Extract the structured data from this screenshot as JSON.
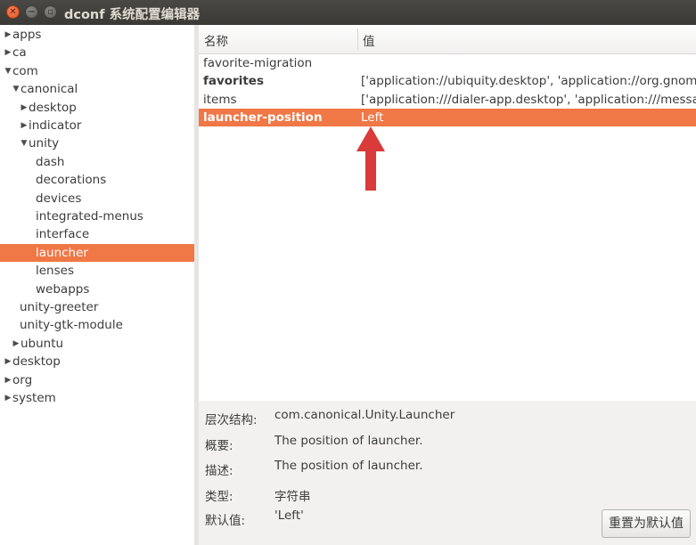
{
  "window": {
    "title": "dconf 系统配置编辑器"
  },
  "tree": [
    {
      "label": "apps",
      "depth": 0,
      "arrow": "right",
      "selected": false
    },
    {
      "label": "ca",
      "depth": 0,
      "arrow": "right",
      "selected": false
    },
    {
      "label": "com",
      "depth": 0,
      "arrow": "down",
      "selected": false
    },
    {
      "label": "canonical",
      "depth": 1,
      "arrow": "down",
      "selected": false
    },
    {
      "label": "desktop",
      "depth": 2,
      "arrow": "right",
      "selected": false
    },
    {
      "label": "indicator",
      "depth": 2,
      "arrow": "right",
      "selected": false
    },
    {
      "label": "unity",
      "depth": 2,
      "arrow": "down",
      "selected": false
    },
    {
      "label": "dash",
      "depth": 3,
      "arrow": "",
      "selected": false
    },
    {
      "label": "decorations",
      "depth": 3,
      "arrow": "",
      "selected": false
    },
    {
      "label": "devices",
      "depth": 3,
      "arrow": "",
      "selected": false
    },
    {
      "label": "integrated-menus",
      "depth": 3,
      "arrow": "",
      "selected": false
    },
    {
      "label": "interface",
      "depth": 3,
      "arrow": "",
      "selected": false
    },
    {
      "label": "launcher",
      "depth": 3,
      "arrow": "",
      "selected": true
    },
    {
      "label": "lenses",
      "depth": 3,
      "arrow": "",
      "selected": false
    },
    {
      "label": "webapps",
      "depth": 3,
      "arrow": "",
      "selected": false
    },
    {
      "label": "unity-greeter",
      "depth": 2,
      "arrow": "",
      "selected": false
    },
    {
      "label": "unity-gtk-module",
      "depth": 2,
      "arrow": "",
      "selected": false
    },
    {
      "label": "ubuntu",
      "depth": 1,
      "arrow": "right",
      "selected": false
    },
    {
      "label": "desktop",
      "depth": 0,
      "arrow": "right",
      "selected": false
    },
    {
      "label": "org",
      "depth": 0,
      "arrow": "right",
      "selected": false
    },
    {
      "label": "system",
      "depth": 0,
      "arrow": "right",
      "selected": false
    }
  ],
  "list": {
    "col_name": "名称",
    "col_value": "值",
    "rows": [
      {
        "key": "favorite-migration",
        "value": "",
        "bold": false,
        "selected": false
      },
      {
        "key": "favorites",
        "value": "['application://ubiquity.desktop', 'application://org.gnome",
        "bold": true,
        "selected": false
      },
      {
        "key": "items",
        "value": "['application:///dialer-app.desktop', 'application:///messa",
        "bold": false,
        "selected": false
      },
      {
        "key": "launcher-position",
        "value": "Left",
        "bold": true,
        "selected": true
      }
    ]
  },
  "details": {
    "schema_label": "层次结构:",
    "schema_value": "com.canonical.Unity.Launcher",
    "summary_label": "概要:",
    "summary_value": "The position of launcher.",
    "description_label": "描述:",
    "description_value": "The position of launcher.",
    "type_label": "类型:",
    "type_value": "字符串",
    "default_label": "默认值:",
    "default_value": "'Left'",
    "reset_button": "重置为默认值"
  },
  "colors": {
    "selection": "#f07746",
    "annotation_arrow": "#d93a3a"
  }
}
